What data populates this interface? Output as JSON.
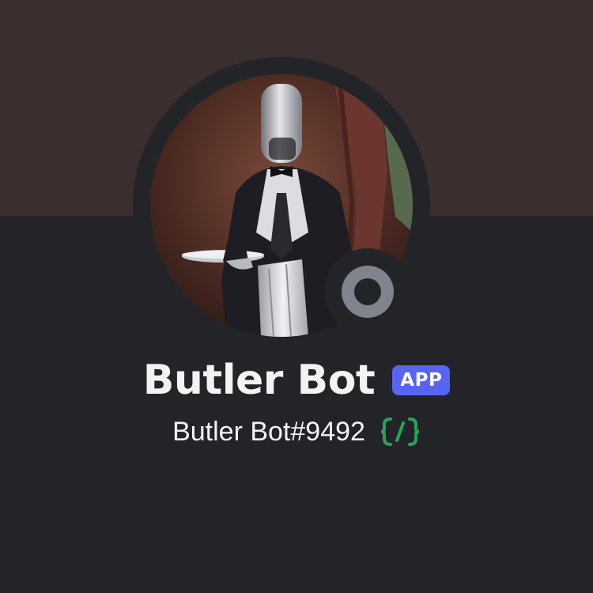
{
  "profile": {
    "display_name": "Butler Bot",
    "badge": "APP",
    "username": "Butler Bot#9492",
    "status": "offline",
    "slash_commands_icon": "slash-commands-icon"
  },
  "colors": {
    "banner": "#3b2e2e",
    "background": "#232428",
    "badge": "#5865f2",
    "status_offline": "#80848e",
    "slash_icon": "#23a55a"
  },
  "avatar": {
    "icon": "butler-robot-avatar"
  }
}
